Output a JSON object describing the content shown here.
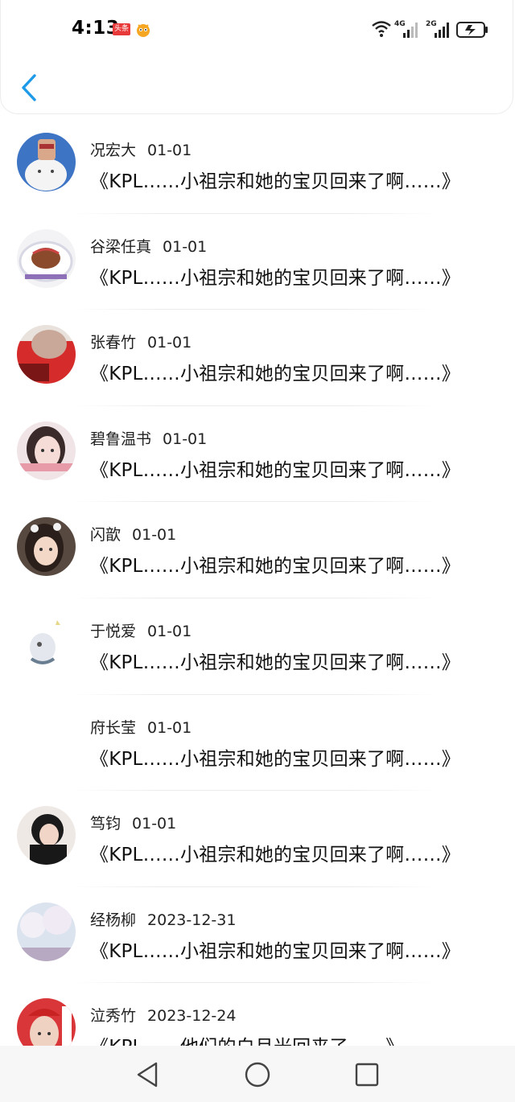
{
  "status_bar": {
    "time": "4:13",
    "badge_text": "头条",
    "net1": "4G",
    "net2": "2G",
    "accent": "#e83a3a"
  },
  "header": {
    "back_icon": "chevron-left-icon",
    "accent": "#1e9be8"
  },
  "comments": [
    {
      "name": "况宏大",
      "date": "01-01",
      "text": "《KPL……小祖宗和她的宝贝回来了啊……》",
      "avatar": "avatar-cat"
    },
    {
      "name": "谷梁任真",
      "date": "01-01",
      "text": "《KPL……小祖宗和她的宝贝回来了啊……》",
      "avatar": "avatar-food"
    },
    {
      "name": "张春竹",
      "date": "01-01",
      "text": "《KPL……小祖宗和她的宝贝回来了啊……》",
      "avatar": "avatar-red"
    },
    {
      "name": "碧鲁温书",
      "date": "01-01",
      "text": "《KPL……小祖宗和她的宝贝回来了啊……》",
      "avatar": "avatar-girl"
    },
    {
      "name": "闪歆",
      "date": "01-01",
      "text": "《KPL……小祖宗和她的宝贝回来了啊……》",
      "avatar": "avatar-selfie"
    },
    {
      "name": "于悦爱",
      "date": "01-01",
      "text": "《KPL……小祖宗和她的宝贝回来了啊……》",
      "avatar": "avatar-sketch"
    },
    {
      "name": "府长莹",
      "date": "01-01",
      "text": "《KPL……小祖宗和她的宝贝回来了啊……》",
      "avatar": "avatar-blank"
    },
    {
      "name": "笃钧",
      "date": "01-01",
      "text": "《KPL……小祖宗和她的宝贝回来了啊……》",
      "avatar": "avatar-boy"
    },
    {
      "name": "经杨柳",
      "date": "2023-12-31",
      "text": "《KPL……小祖宗和她的宝贝回来了啊……》",
      "avatar": "avatar-blossom"
    },
    {
      "name": "泣秀竹",
      "date": "2023-12-24",
      "text": "《KPL……他们的白月光回来了……》",
      "avatar": "avatar-poster"
    }
  ],
  "nav": {
    "back": "triangle-back-icon",
    "home": "circle-home-icon",
    "recents": "square-recents-icon"
  }
}
